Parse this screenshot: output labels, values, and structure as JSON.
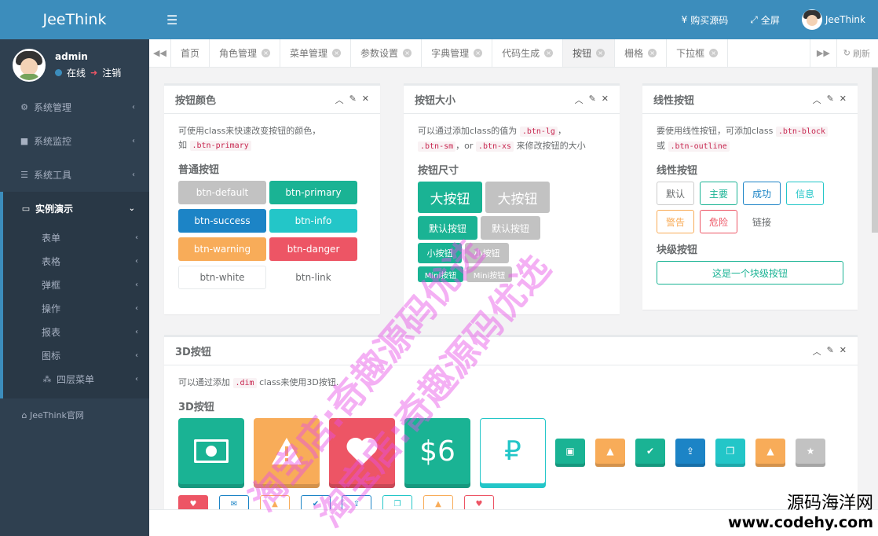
{
  "brand": "JeeThink",
  "user": {
    "name": "admin",
    "status": "在线",
    "logout": "注销"
  },
  "sidebar": {
    "items": [
      {
        "label": "系统管理"
      },
      {
        "label": "系统监控"
      },
      {
        "label": "系统工具"
      }
    ],
    "active": {
      "label": "实例演示"
    },
    "subitems": [
      {
        "label": "表单"
      },
      {
        "label": "表格"
      },
      {
        "label": "弹框"
      },
      {
        "label": "操作"
      },
      {
        "label": "报表"
      },
      {
        "label": "图标"
      },
      {
        "label": "四层菜单"
      }
    ],
    "footer": "JeeThink官网"
  },
  "topbar": {
    "buy": "购买源码",
    "fullscreen": "全屏",
    "user": "JeeThink"
  },
  "tabs": [
    {
      "label": "首页",
      "closable": false
    },
    {
      "label": "角色管理",
      "closable": true
    },
    {
      "label": "菜单管理",
      "closable": true
    },
    {
      "label": "参数设置",
      "closable": true
    },
    {
      "label": "字典管理",
      "closable": true
    },
    {
      "label": "代码生成",
      "closable": true
    },
    {
      "label": "按钮",
      "closable": true
    },
    {
      "label": "栅格",
      "closable": true
    },
    {
      "label": "下拉框",
      "closable": true
    }
  ],
  "refresh": "刷新",
  "colors": {
    "primary": "#1ab394",
    "success": "#1c84c6",
    "info": "#23c6c8",
    "warning": "#f8ac59",
    "danger": "#ed5565",
    "default": "#c2c2c2",
    "accent": "#3c8dbc",
    "sidebar": "#2f4050"
  },
  "panel_colors": {
    "title": "按钮颜色",
    "desc_a": "可使用class来快速改变按钮的颜色，",
    "desc_b": "如",
    "code": ".btn-primary",
    "section": "普通按钮",
    "buttons": [
      "btn-default",
      "btn-primary",
      "btn-success",
      "btn-info",
      "btn-warning",
      "btn-danger",
      "btn-white",
      "btn-link"
    ]
  },
  "panel_sizes": {
    "title": "按钮大小",
    "desc_a": "可以通过添加class的值为",
    "code1": ".btn-lg",
    "code2": ".btn-sm",
    "sep": "，or",
    "code3": ".btn-xs",
    "desc_b": "来修改按钮的大小",
    "section": "按钮尺寸",
    "lg": "大按钮",
    "md": "默认按钮",
    "sm": "小按钮",
    "xs": "Mini按钮"
  },
  "panel_outline": {
    "title": "线性按钮",
    "desc_a": "要使用线性按钮，可添加class",
    "code1": ".btn-block",
    "desc_b": "或",
    "code2": ".btn-outline",
    "section": "线性按钮",
    "buttons": [
      "默认",
      "主要",
      "成功",
      "信息",
      "警告",
      "危险",
      "链接"
    ],
    "section2": "块级按钮",
    "block": "这是一个块级按钮"
  },
  "panel_3d": {
    "title": "3D按钮",
    "desc_a": "可以通过添加",
    "code": ".dim",
    "desc_b": "class来使用3D按钮.",
    "section": "3D按钮",
    "big_dollar": "$6"
  },
  "watermarks": {
    "w1": "淘宝店:奇趣源码优选",
    "w2": "淘宝店:奇趣源码优选"
  },
  "corner_wm": {
    "a": "源码海洋网",
    "b": "www.codehy.com"
  }
}
